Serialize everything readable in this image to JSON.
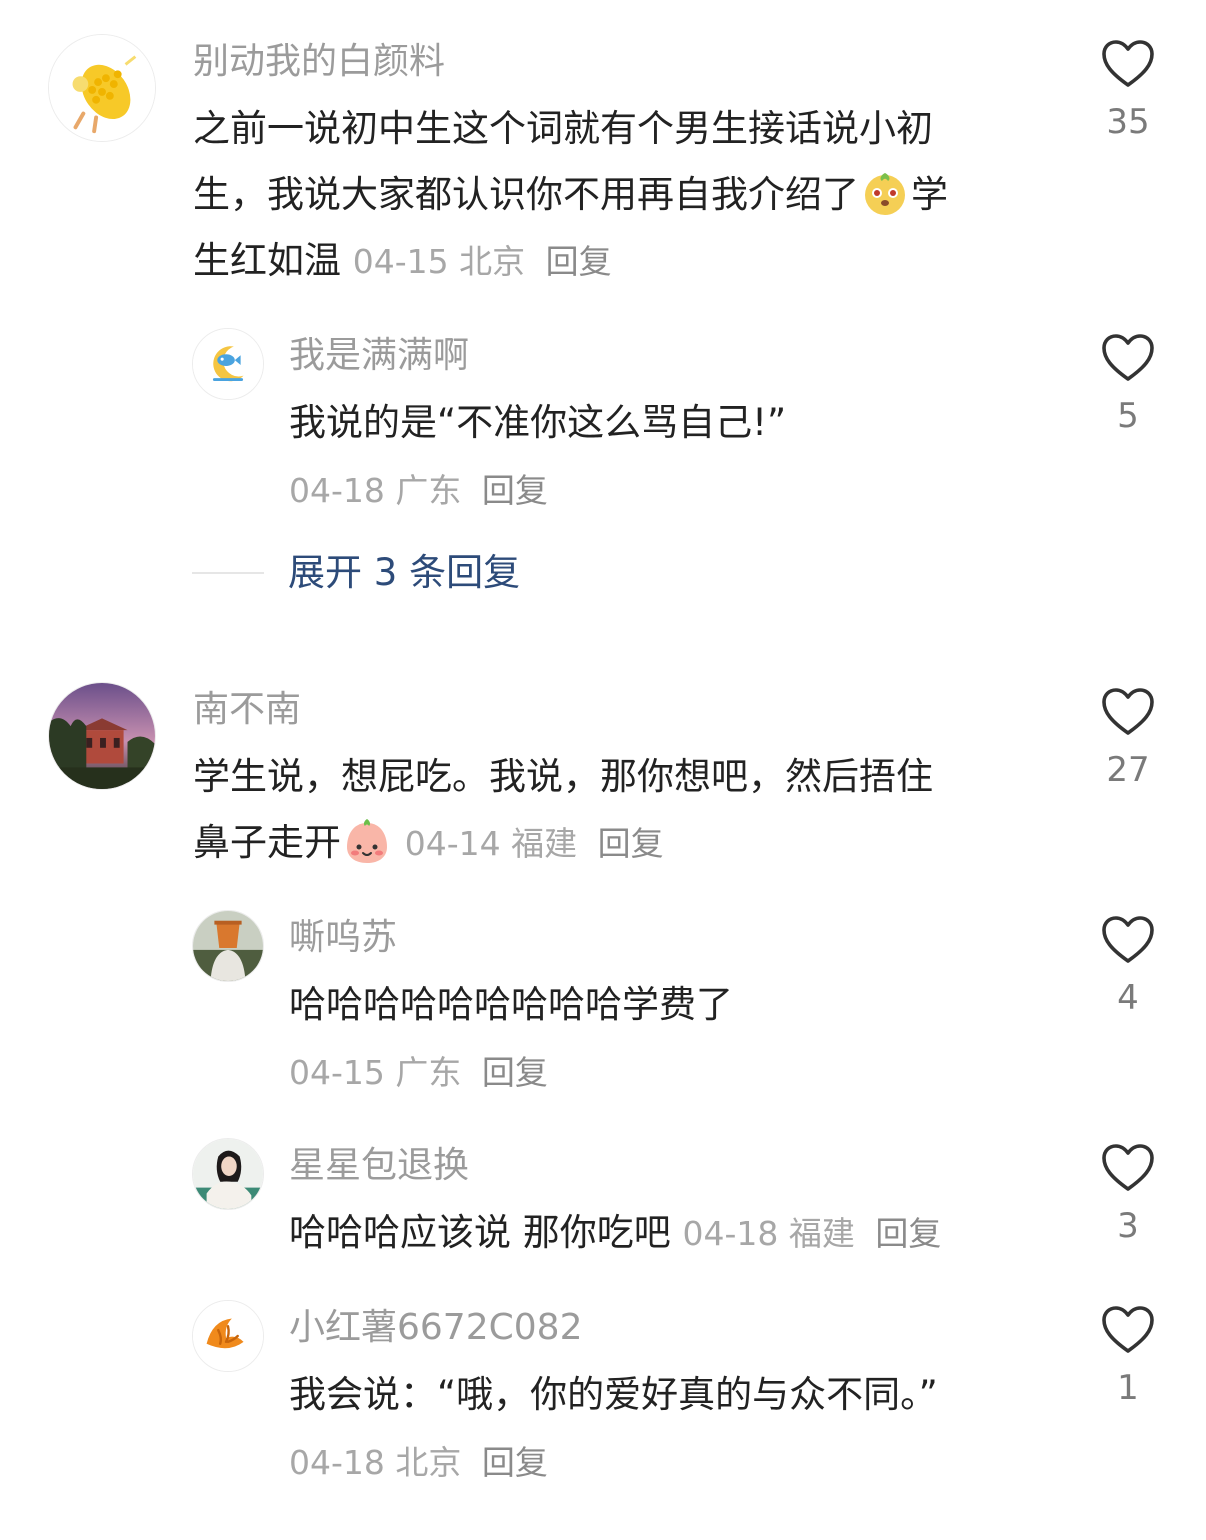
{
  "comments": [
    {
      "author": "别动我的白颜料",
      "avatar": "corn-avatar-icon",
      "text_line1": "之前一说初中生这个词就有个男生接话说小初",
      "text_line2a": "生，我说大家都认识你不用再自我介绍了",
      "emoji": "smirk-dog-emoji",
      "text_line2b": "学",
      "text_line3": "生红如温",
      "date": "04-15",
      "location": "北京",
      "reply": "回复",
      "likes": "35"
    },
    {
      "author": "我是满满啊",
      "avatar": "moon-fish-avatar-icon",
      "text": "我说的是“不准你这么骂自己!”",
      "date": "04-18",
      "location": "广东",
      "reply": "回复",
      "likes": "5"
    },
    {
      "author": "南不南",
      "avatar": "sunset-building-avatar-icon",
      "text_line1": "学生说，想屁吃。我说，那你想吧，然后捂住",
      "text_line2": "鼻子走开",
      "emoji": "pink-blush-emoji",
      "date": "04-14",
      "location": "福建",
      "reply": "回复",
      "likes": "27"
    },
    {
      "author": "嘶呜苏",
      "avatar": "bucket-head-avatar-icon",
      "text": "哈哈哈哈哈哈哈哈哈学费了",
      "date": "04-15",
      "location": "广东",
      "reply": "回复",
      "likes": "4"
    },
    {
      "author": "星星包退换",
      "avatar": "girl-portrait-avatar-icon",
      "text": "哈哈哈应该说 那你吃吧",
      "date": "04-18",
      "location": "福建",
      "reply": "回复",
      "likes": "3"
    },
    {
      "author": "小红薯6672C082",
      "avatar": "croissant-avatar-icon",
      "text": "我会说：“哦，你的爱好真的与众不同。”",
      "date": "04-18",
      "location": "北京",
      "reply": "回复",
      "likes": "1"
    }
  ],
  "expand": {
    "label": "展开 3 条回复"
  },
  "colors": {
    "link": "#2d4b79",
    "muted": "#9b9b9b",
    "text": "#222222"
  }
}
